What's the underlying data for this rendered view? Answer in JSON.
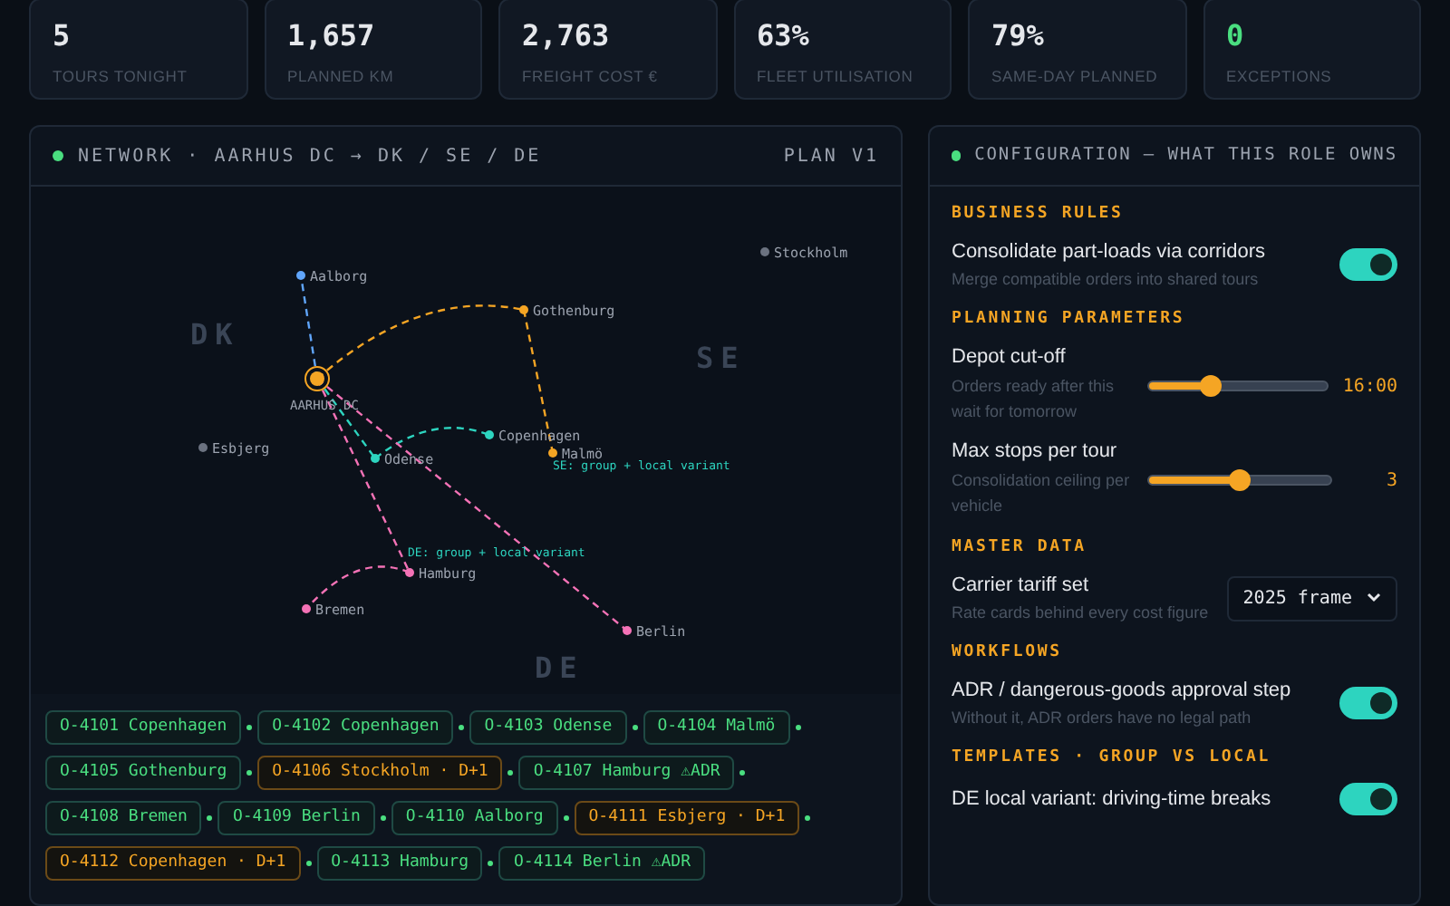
{
  "kpis": [
    {
      "value": "5",
      "label": "TOURS TONIGHT",
      "kind": "plain"
    },
    {
      "value": "1,657",
      "label": "PLANNED KM",
      "kind": "plain"
    },
    {
      "value": "2,763",
      "label": "FREIGHT COST €",
      "kind": "plain"
    },
    {
      "value": "63%",
      "label": "FLEET UTILISATION",
      "kind": "plain"
    },
    {
      "value": "79%",
      "label": "SAME-DAY PLANNED",
      "kind": "plain"
    },
    {
      "value": "0",
      "label": "EXCEPTIONS",
      "kind": "good"
    }
  ],
  "network": {
    "title": "NETWORK · AARHUS DC → DK / SE / DE",
    "badge": "PLAN V1",
    "regions": [
      "DK",
      "SE",
      "DE"
    ],
    "nodes": [
      {
        "name": "Stockholm",
        "kind": "stop",
        "color": "#6b7280"
      },
      {
        "name": "Aalborg",
        "kind": "stop",
        "color": "#60a5fa"
      },
      {
        "name": "Gothenburg",
        "kind": "stop",
        "color": "#f5a524"
      },
      {
        "name": "AARHUS DC",
        "kind": "depot",
        "color": "#f5a524"
      },
      {
        "name": "Copenhagen",
        "kind": "stop",
        "color": "#2dd4bf"
      },
      {
        "name": "Esbjerg",
        "kind": "stop",
        "color": "#6b7280"
      },
      {
        "name": "Malmö",
        "kind": "stop",
        "color": "#f5a524"
      },
      {
        "name": "Odense",
        "kind": "stop",
        "color": "#2dd4bf"
      },
      {
        "name": "Hamburg",
        "kind": "stop",
        "color": "#f472b6"
      },
      {
        "name": "Bremen",
        "kind": "stop",
        "color": "#f472b6"
      },
      {
        "name": "Berlin",
        "kind": "stop",
        "color": "#f472b6"
      }
    ],
    "notes": [
      "SE: group + local variant",
      "DE: group + local variant"
    ],
    "orders": [
      {
        "label": "O-4101 Copenhagen",
        "kind": "same_day"
      },
      {
        "label": "O-4102 Copenhagen",
        "kind": "same_day"
      },
      {
        "label": "O-4103 Odense",
        "kind": "same_day"
      },
      {
        "label": "O-4104 Malmö",
        "kind": "same_day"
      },
      {
        "label": "O-4105 Gothenburg",
        "kind": "same_day"
      },
      {
        "label": "O-4106 Stockholm · D+1",
        "kind": "next_day"
      },
      {
        "label": "O-4107 Hamburg ⚠ADR",
        "kind": "same_day"
      },
      {
        "label": "O-4108 Bremen",
        "kind": "same_day"
      },
      {
        "label": "O-4109 Berlin",
        "kind": "same_day"
      },
      {
        "label": "O-4110 Aalborg",
        "kind": "same_day"
      },
      {
        "label": "O-4111 Esbjerg · D+1",
        "kind": "next_day"
      },
      {
        "label": "O-4112 Copenhagen · D+1",
        "kind": "next_day"
      },
      {
        "label": "O-4113 Hamburg",
        "kind": "same_day"
      },
      {
        "label": "O-4114 Berlin ⚠ADR",
        "kind": "same_day"
      }
    ]
  },
  "config": {
    "title": "CONFIGURATION — WHAT THIS ROLE OWNS",
    "sections": [
      {
        "heading": "BUSINESS RULES",
        "items": [
          {
            "kind": "toggle",
            "label": "Consolidate part-loads via corridors",
            "hint": "Merge compatible orders into shared tours",
            "on": true
          }
        ]
      },
      {
        "heading": "PLANNING PARAMETERS",
        "items": [
          {
            "kind": "slider",
            "label": "Depot cut-off",
            "hint": "Orders ready after this wait for tomorrow",
            "level": 0.35,
            "reading": "16:00"
          },
          {
            "kind": "slider",
            "label": "Max stops per tour",
            "hint": "Consolidation ceiling per vehicle",
            "level": 0.5,
            "reading": "3"
          }
        ]
      },
      {
        "heading": "MASTER DATA",
        "items": [
          {
            "kind": "select",
            "label": "Carrier tariff set",
            "hint": "Rate cards behind every cost figure",
            "value": "2025 frame"
          }
        ]
      },
      {
        "heading": "WORKFLOWS",
        "items": [
          {
            "kind": "toggle",
            "label": "ADR / dangerous-goods approval step",
            "hint": "Without it, ADR orders have no legal path",
            "on": true
          }
        ]
      },
      {
        "heading": "TEMPLATES · GROUP VS LOCAL",
        "items": [
          {
            "kind": "toggle",
            "label": "DE local variant: driving-time breaks",
            "on": true
          }
        ]
      }
    ]
  }
}
